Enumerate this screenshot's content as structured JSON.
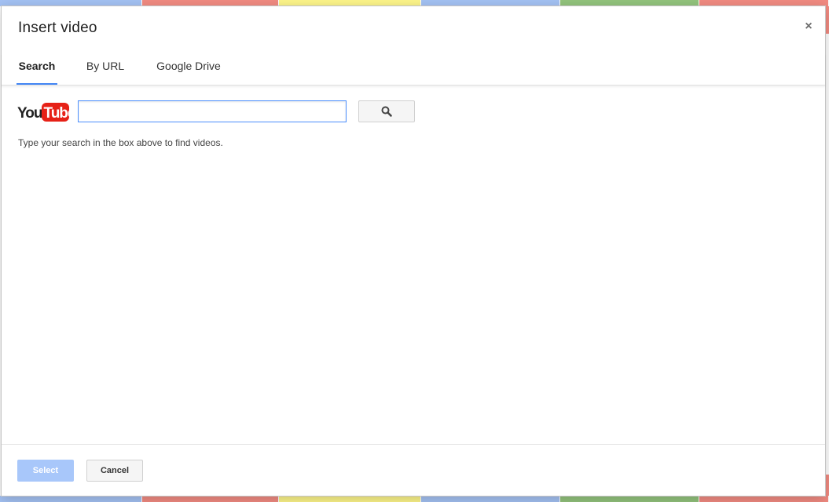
{
  "dialog": {
    "title": "Insert video",
    "close_label": "×"
  },
  "tabs": [
    {
      "label": "Search",
      "active": true
    },
    {
      "label": "By URL",
      "active": false
    },
    {
      "label": "Google Drive",
      "active": false
    }
  ],
  "search": {
    "logo_text_you": "You",
    "logo_text_tube": "Tube",
    "input_value": "",
    "button_icon": "search-icon",
    "hint": "Type your search in the box above to find videos."
  },
  "footer": {
    "select_label": "Select",
    "cancel_label": "Cancel"
  },
  "colors": {
    "accent": "#4285f4",
    "youtube_red": "#e62117",
    "select_disabled": "#a8c7fa",
    "strip_blue": "#a4c2f4",
    "strip_red": "#f28b82",
    "strip_yellow": "#fdf58a",
    "strip_green": "#93c47d"
  }
}
